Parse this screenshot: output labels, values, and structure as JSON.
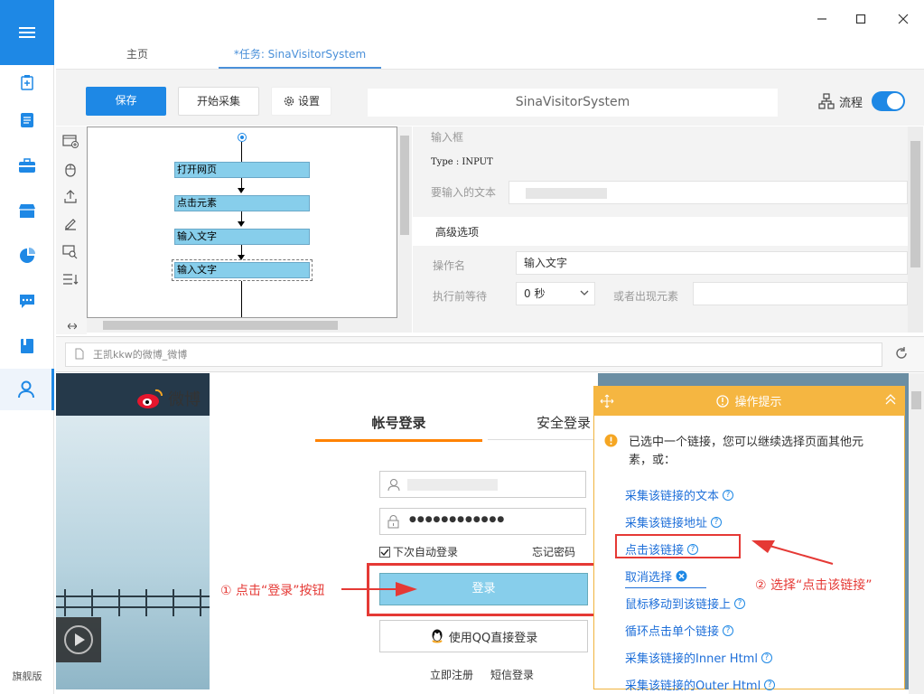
{
  "sidebar": {
    "edition": "旗舰版",
    "items": [
      {
        "icon": "clipboard-plus-icon"
      },
      {
        "icon": "document-icon"
      },
      {
        "icon": "briefcase-icon"
      },
      {
        "icon": "store-icon"
      },
      {
        "icon": "pie-chart-icon"
      },
      {
        "icon": "chat-icon"
      },
      {
        "icon": "book-icon"
      },
      {
        "icon": "user-icon"
      }
    ]
  },
  "tabs": {
    "home": "主页",
    "task": "*任务: SinaVisitorSystem"
  },
  "toolbar": {
    "save": "保存",
    "start": "开始采集",
    "settings": "设置",
    "task_name": "SinaVisitorSystem",
    "flow": "流程"
  },
  "flow": {
    "nodes": [
      "打开网页",
      "点击元素",
      "输入文字",
      "输入文字"
    ]
  },
  "props": {
    "section_title": "输入框",
    "type_line": "Type : INPUT",
    "input_text_label": "要输入的文本",
    "advanced": "高级选项",
    "op_name_label": "操作名",
    "op_name_value": "输入文字",
    "wait_label": "执行前等待",
    "wait_value": "0 秒",
    "or_appear_label": "或者出现元素"
  },
  "address": {
    "title": "王凯kkw的微博_微博"
  },
  "weibo": {
    "logo_text": "微博",
    "tab_account": "帐号登录",
    "tab_secure": "安全登录",
    "password_mask": "●●●●●●●●●●●●",
    "remember": "下次自动登录",
    "forgot": "忘记密码",
    "login": "登录",
    "qq_login": "使用QQ直接登录",
    "register": "立即注册",
    "sms_login": "短信登录"
  },
  "tips": {
    "title": "操作提示",
    "message": "已选中一个链接，您可以继续选择页面其他元素，或：",
    "links": [
      "采集该链接的文本",
      "采集该链接地址",
      "点击该链接",
      "取消选择",
      "鼠标移动到该链接上",
      "循环点击单个链接",
      "采集该链接的Inner Html",
      "采集该链接的Outer Html"
    ]
  },
  "annotations": {
    "step1": "① 点击“登录”按钮",
    "step2": "② 选择“点击该链接”"
  },
  "colors": {
    "accent": "#1e88e5",
    "tips_header": "#f5b641",
    "annotation_red": "#e53935",
    "node_fill": "#87ceeb"
  }
}
